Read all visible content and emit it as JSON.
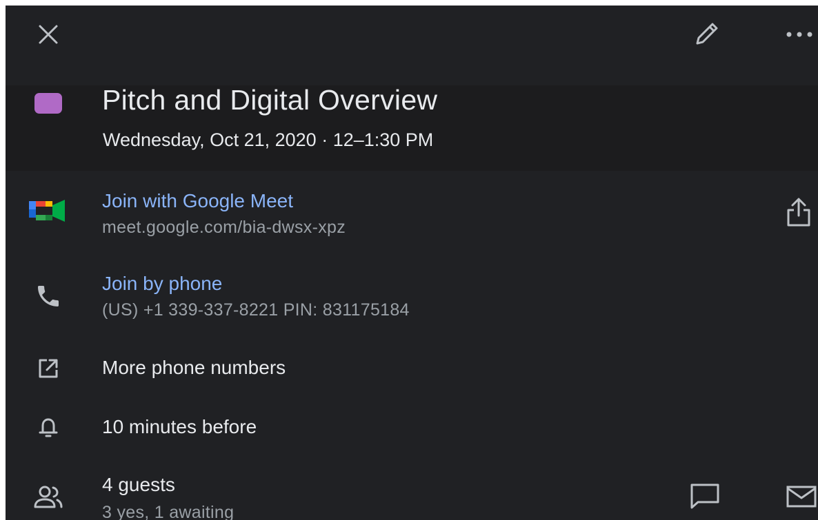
{
  "event": {
    "title": "Pitch and Digital Overview",
    "datetime": "Wednesday, Oct 21, 2020 · 12–1:30 PM",
    "color": "#b06ac6"
  },
  "toolbar": {
    "close_icon": "close-icon",
    "edit_icon": "pencil-icon",
    "more_icon": "more-horizontal-icon"
  },
  "meet": {
    "label": "Join with Google Meet",
    "url": "meet.google.com/bia-dwsx-xpz",
    "icon": "google-meet-icon",
    "share_icon": "share-icon"
  },
  "phone": {
    "label": "Join by phone",
    "details": "(US) +1 339-337-8221 PIN: 831175184",
    "icon": "phone-icon"
  },
  "more_numbers": {
    "label": "More phone numbers",
    "icon": "external-link-icon"
  },
  "reminder": {
    "label": "10 minutes before",
    "icon": "bell-icon"
  },
  "guests": {
    "label": "4 guests",
    "summary": "3 yes, 1 awaiting",
    "icon": "people-icon",
    "chat_icon": "chat-icon",
    "mail_icon": "mail-icon"
  },
  "colors": {
    "background": "#202124",
    "link": "#8ab4f8",
    "primary_text": "#e8eaed",
    "secondary_text": "#9aa0a6",
    "icon": "#bdc1c6"
  }
}
